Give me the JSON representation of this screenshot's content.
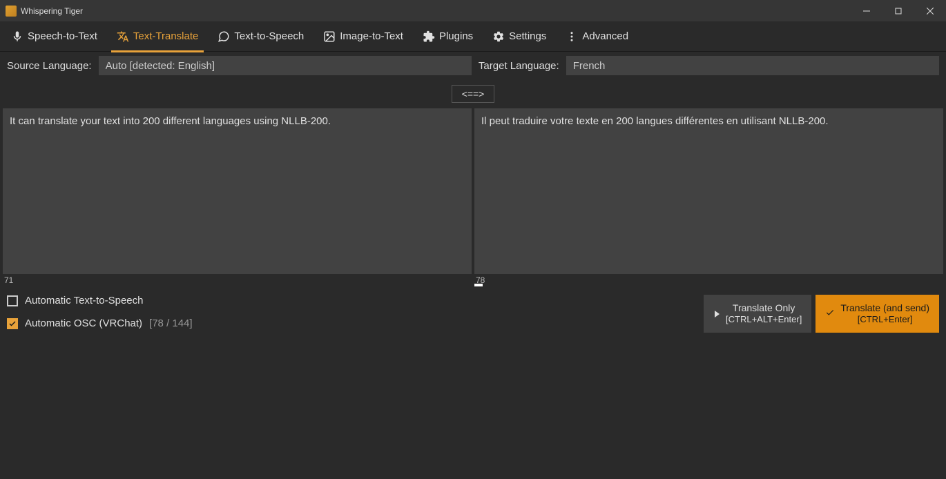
{
  "window": {
    "title": "Whispering Tiger"
  },
  "tabs": {
    "speech_to_text": "Speech-to-Text",
    "text_translate": "Text-Translate",
    "text_to_speech": "Text-to-Speech",
    "image_to_text": "Image-to-Text",
    "plugins": "Plugins",
    "settings": "Settings",
    "advanced": "Advanced"
  },
  "lang": {
    "source_label": "Source Language:",
    "source_value": "Auto [detected: English]",
    "target_label": "Target Language:",
    "target_value": "French",
    "swap": "<==>"
  },
  "text": {
    "source": "It can translate your text into 200 different languages using NLLB-200.",
    "target": "Il peut traduire votre texte en 200 langues différentes en utilisant NLLB-200.",
    "source_count": "71",
    "target_count": "78"
  },
  "checks": {
    "tts_label": "Automatic Text-to-Speech",
    "osc_label": "Automatic OSC (VRChat)",
    "osc_count": "[78 / 144]"
  },
  "buttons": {
    "translate_only": "Translate Only",
    "translate_only_sub": "[CTRL+ALT+Enter]",
    "translate_send": "Translate (and send)",
    "translate_send_sub": "[CTRL+Enter]"
  }
}
